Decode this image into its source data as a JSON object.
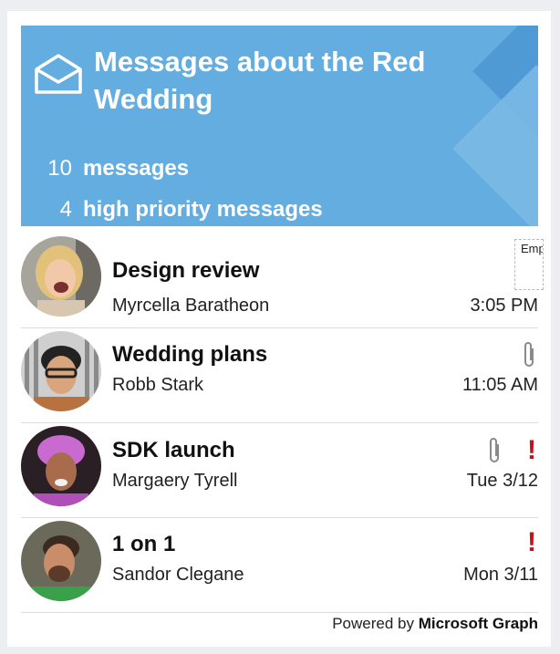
{
  "header": {
    "title": "Messages about the Red Wedding",
    "icon": "envelope-open-icon",
    "stats": [
      {
        "count": "10",
        "label": "messages"
      },
      {
        "count": "4",
        "label": "high priority messages"
      }
    ],
    "colors": {
      "background": "#64ade0",
      "text": "#ffffff"
    }
  },
  "messages": [
    {
      "subject": "Design review",
      "sender": "Myrcella Baratheon",
      "time": "3:05 PM",
      "attachment": false,
      "high_priority": false,
      "placeholder": "Empty Column"
    },
    {
      "subject": "Wedding plans",
      "sender": "Robb Stark",
      "time": "11:05 AM",
      "attachment": true,
      "high_priority": false
    },
    {
      "subject": "SDK launch",
      "sender": "Margaery Tyrell",
      "time": "Tue 3/12",
      "attachment": true,
      "high_priority": true
    },
    {
      "subject": "1 on 1",
      "sender": "Sandor Clegane",
      "time": "Mon 3/11",
      "attachment": false,
      "high_priority": true
    }
  ],
  "footer": {
    "prefix": "Powered by",
    "brand": "Microsoft Graph"
  },
  "icons": {
    "attachment": "paperclip-icon",
    "priority": "exclamation-icon",
    "priority_color": "#c4111b"
  }
}
